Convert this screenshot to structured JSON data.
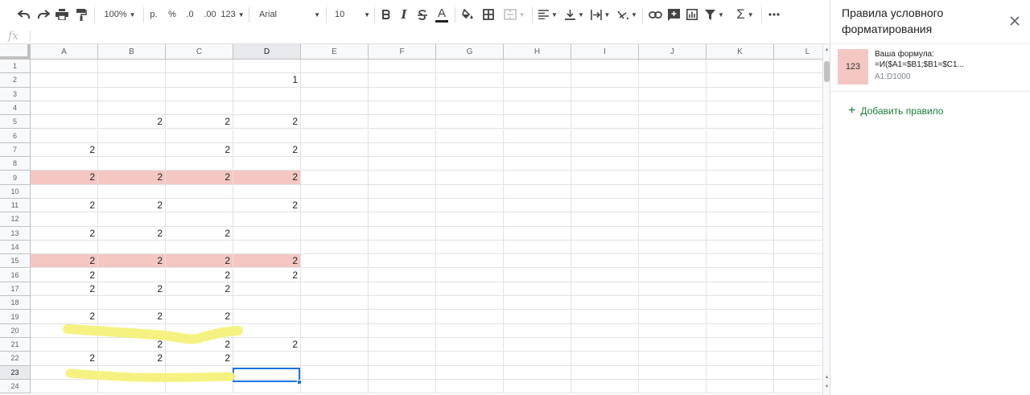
{
  "toolbar": {
    "zoom": "100%",
    "currency": "р.",
    "percent": "%",
    "decrease_decimals": ".0",
    "increase_decimals": ".00",
    "more_formats": "123",
    "font": "Arial",
    "font_size": "10",
    "italic": "I",
    "text_color_letter": "A",
    "functions": "Σ"
  },
  "formula_bar": {
    "fx_label": "fx"
  },
  "grid": {
    "columns": [
      "A",
      "B",
      "C",
      "D",
      "E",
      "F",
      "G",
      "H",
      "I",
      "J",
      "K",
      "L"
    ],
    "selected_column": "D",
    "selected_row": 23,
    "rows": [
      {
        "n": 1,
        "cells": [
          "",
          "",
          "",
          ""
        ]
      },
      {
        "n": 2,
        "cells": [
          "",
          "",
          "",
          "1"
        ]
      },
      {
        "n": 3,
        "cells": [
          "",
          "",
          "",
          ""
        ]
      },
      {
        "n": 4,
        "cells": [
          "",
          "",
          "",
          ""
        ]
      },
      {
        "n": 5,
        "cells": [
          "",
          "2",
          "2",
          "2"
        ]
      },
      {
        "n": 6,
        "cells": [
          "",
          "",
          "",
          ""
        ]
      },
      {
        "n": 7,
        "cells": [
          "2",
          "",
          "2",
          "2"
        ]
      },
      {
        "n": 8,
        "cells": [
          "",
          "",
          "",
          ""
        ]
      },
      {
        "n": 9,
        "cells": [
          "2",
          "2",
          "2",
          "2"
        ],
        "highlight": true
      },
      {
        "n": 10,
        "cells": [
          "",
          "",
          "",
          ""
        ]
      },
      {
        "n": 11,
        "cells": [
          "2",
          "2",
          "",
          "2"
        ]
      },
      {
        "n": 12,
        "cells": [
          "",
          "",
          "",
          ""
        ]
      },
      {
        "n": 13,
        "cells": [
          "2",
          "2",
          "2",
          ""
        ]
      },
      {
        "n": 14,
        "cells": [
          "",
          "",
          "",
          ""
        ]
      },
      {
        "n": 15,
        "cells": [
          "2",
          "2",
          "2",
          "2"
        ],
        "highlight": true
      },
      {
        "n": 16,
        "cells": [
          "2",
          "",
          "2",
          "2"
        ]
      },
      {
        "n": 17,
        "cells": [
          "2",
          "2",
          "2",
          ""
        ]
      },
      {
        "n": 18,
        "cells": [
          "",
          "",
          "",
          ""
        ]
      },
      {
        "n": 19,
        "cells": [
          "2",
          "2",
          "2",
          ""
        ]
      },
      {
        "n": 20,
        "cells": [
          "",
          "",
          "",
          ""
        ]
      },
      {
        "n": 21,
        "cells": [
          "",
          "2",
          "2",
          "2"
        ]
      },
      {
        "n": 22,
        "cells": [
          "2",
          "2",
          "2",
          ""
        ]
      },
      {
        "n": 23,
        "cells": [
          "",
          "",
          "",
          ""
        ]
      },
      {
        "n": 24,
        "cells": [
          "",
          "",
          "",
          ""
        ]
      }
    ]
  },
  "panel": {
    "title": "Правила условного форматирования",
    "rule": {
      "preview": "123",
      "type": "Ваша формула:",
      "formula": "=И($A1=$B1;$B1=$C1...",
      "range": "A1:D1000",
      "fill_color": "#f4c7c3"
    },
    "add_rule": "Добавить правило"
  },
  "colors": {
    "highlight": "#f4c7c3",
    "selection": "#1a73e8",
    "marker": "#f6f17a",
    "add_rule": "#188038"
  }
}
